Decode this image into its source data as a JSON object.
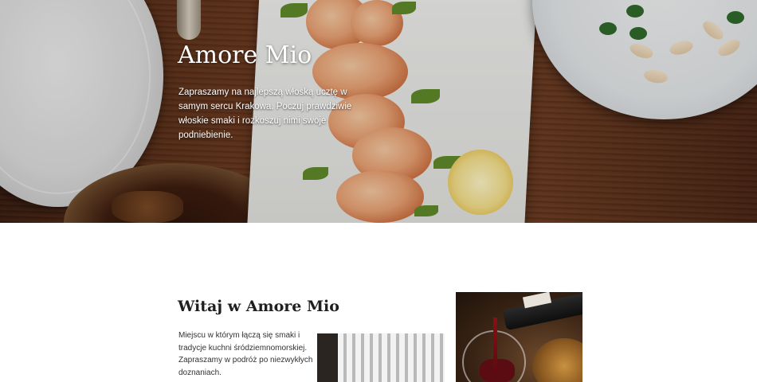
{
  "hero": {
    "title": "Amore Mio",
    "text": "Zapraszamy na najlepszą włoską ucztę w samym sercu Krakowa. Poczuj prawdziwie włoskie smaki i rozkoszuj nimi swoje podniebienie."
  },
  "welcome": {
    "title": "Witaj w Amore Mio",
    "text": "Miejscu w którym łączą się smaki i tradycje kuchni śródziemnomorskiej. Zapraszamy w podróż po niezwykłych doznaniach."
  }
}
